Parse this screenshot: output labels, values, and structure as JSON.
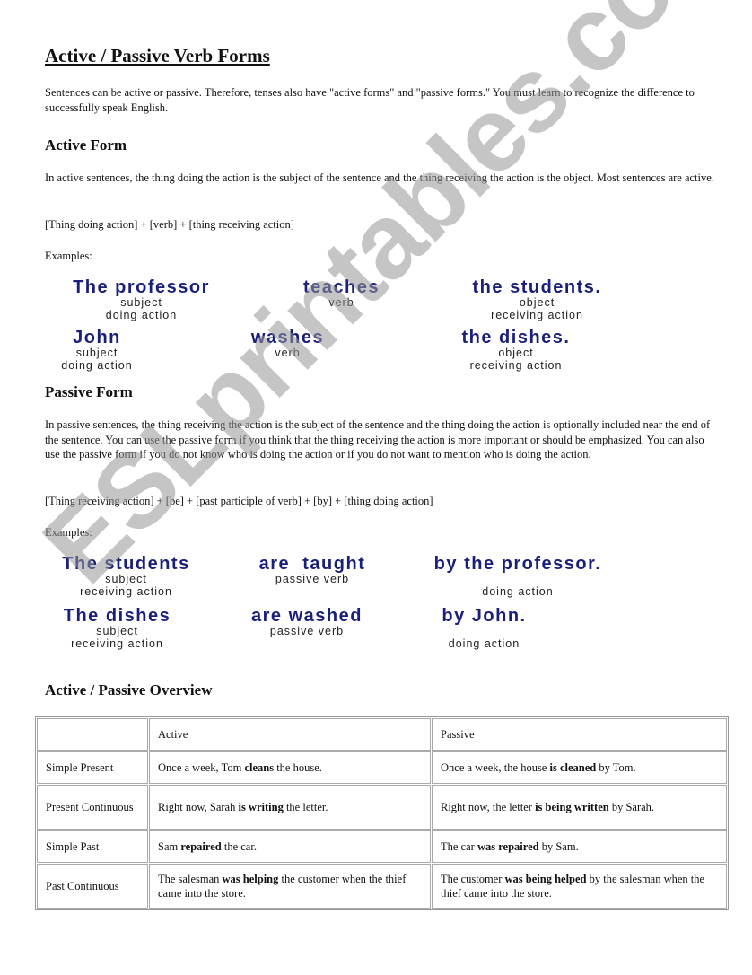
{
  "title": "Active / Passive Verb Forms",
  "intro": "Sentences can be active or passive. Therefore, tenses also have \"active forms\" and \"passive forms.\" You must learn to recognize the difference to successfully speak English.",
  "active": {
    "heading": "Active Form",
    "description": "In active sentences, the thing doing the action is the subject of the sentence and the thing receiving the action is the object. Most sentences are active.",
    "formula": "[Thing doing action] + [verb] + [thing receiving action]",
    "examples_label": "Examples:",
    "examples": [
      {
        "subject": {
          "text": "The professor",
          "label1": "subject",
          "label2": "doing action"
        },
        "verb": {
          "text": "teaches",
          "label1": "verb",
          "label2": ""
        },
        "object": {
          "text": "the students.",
          "label1": "object",
          "label2": "receiving action"
        }
      },
      {
        "subject": {
          "text": "John",
          "label1": "subject",
          "label2": "doing action"
        },
        "verb": {
          "text": "washes",
          "label1": "verb",
          "label2": ""
        },
        "object": {
          "text": "the dishes.",
          "label1": "object",
          "label2": "receiving action"
        }
      }
    ]
  },
  "passive": {
    "heading": "Passive Form",
    "description": "In passive sentences, the thing receiving the action is the subject of the sentence and the thing doing the action is optionally included near the end of the sentence.  You can use the passive form if you think that the thing receiving the action is more important or should be emphasized.  You can also use the passive form if you do not know who is doing the action or if you do not want to mention who is doing the action.",
    "formula": "[Thing receiving action] + [be] + [past participle of verb] + [by] + [thing doing action]",
    "examples_label": "Examples:",
    "examples": [
      {
        "subject": {
          "text": "The students",
          "label1": "subject",
          "label2": "receiving action"
        },
        "verb": {
          "text": "are  taught",
          "label1": "passive verb",
          "label2": ""
        },
        "agent": {
          "text": "by the professor.",
          "label1": "",
          "label2": "doing action"
        }
      },
      {
        "subject": {
          "text": "The dishes",
          "label1": "subject",
          "label2": "receiving action"
        },
        "verb": {
          "text": "are washed",
          "label1": "passive verb",
          "label2": ""
        },
        "agent": {
          "text": "by John.",
          "label1": "",
          "label2": "doing action"
        }
      }
    ]
  },
  "overview": {
    "heading": "Active / Passive Overview",
    "columns": [
      "",
      "Active",
      "Passive"
    ],
    "rows": [
      {
        "tense": "Simple Present",
        "active": {
          "pre": "Once a week, Tom ",
          "bold": "cleans",
          "post": " the house."
        },
        "passive": {
          "pre": "Once a week, the house ",
          "bold": "is cleaned",
          "post": " by Tom."
        }
      },
      {
        "tense": "Present Continuous",
        "active": {
          "pre": "Right now, Sarah ",
          "bold": "is writing",
          "post": " the letter."
        },
        "passive": {
          "pre": "Right now, the letter ",
          "bold": "is being written",
          "post": " by Sarah."
        }
      },
      {
        "tense": "Simple Past",
        "active": {
          "pre": "Sam ",
          "bold": "repaired",
          "post": " the car."
        },
        "passive": {
          "pre": "The car ",
          "bold": "was repaired",
          "post": " by Sam."
        }
      },
      {
        "tense": "Past Continuous",
        "active": {
          "pre": "The salesman ",
          "bold": "was helping",
          "post": " the customer when the thief came into the store."
        },
        "passive": {
          "pre": "The customer ",
          "bold": "was being helped",
          "post": " by the salesman when the thief came into the store."
        }
      }
    ]
  },
  "watermark": "ESLprintables.com",
  "colors": {
    "example_text": "#1a1f7a",
    "watermark": "#969696"
  }
}
